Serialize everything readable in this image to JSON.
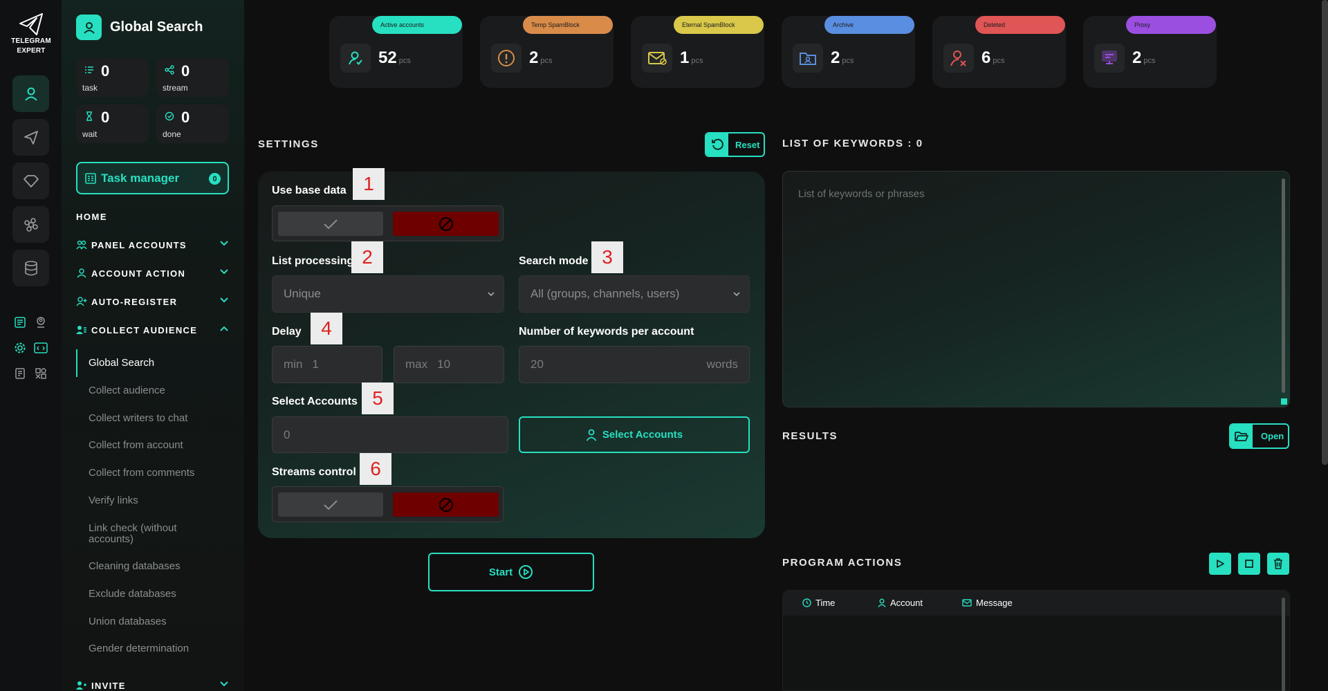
{
  "logo": {
    "line1": "TELEGRAM",
    "line2": "EXPERT"
  },
  "header": {
    "title": "Global Search"
  },
  "stats": [
    {
      "value": "0",
      "label": "task"
    },
    {
      "value": "0",
      "label": "stream"
    },
    {
      "value": "0",
      "label": "wait"
    },
    {
      "value": "0",
      "label": "done"
    }
  ],
  "task_manager": {
    "label": "Task manager",
    "badge": "0"
  },
  "nav": {
    "home": "HOME",
    "sections": [
      {
        "label": "PANEL ACCOUNTS",
        "icon": "users-icon",
        "expanded": false
      },
      {
        "label": "ACCOUNT ACTION",
        "icon": "user-icon",
        "expanded": false
      },
      {
        "label": "AUTO-REGISTER",
        "icon": "user-plus-icon",
        "expanded": false
      },
      {
        "label": "COLLECT AUDIENCE",
        "icon": "user-list-icon",
        "expanded": true
      },
      {
        "label": "INVITE",
        "icon": "user-invite-icon",
        "expanded": false
      }
    ],
    "collect_audience_items": [
      {
        "label": "Global Search",
        "active": true
      },
      {
        "label": "Collect audience"
      },
      {
        "label": "Collect writers to chat"
      },
      {
        "label": "Collect from account"
      },
      {
        "label": "Collect from comments"
      },
      {
        "label": "Verify links"
      },
      {
        "label": "Link check (without accounts)"
      },
      {
        "label": "Cleaning databases"
      },
      {
        "label": "Exclude databases"
      },
      {
        "label": "Union databases"
      },
      {
        "label": "Gender determination"
      }
    ]
  },
  "counters": [
    {
      "tag": "Active accounts",
      "value": "52",
      "unit": "pcs",
      "color": "#27e0c1",
      "icon": "user-check-icon"
    },
    {
      "tag": "Temp SpamBlock",
      "value": "2",
      "unit": "pcs",
      "color": "#d98c4a",
      "icon": "warning-icon"
    },
    {
      "tag": "Eternal SpamBlock",
      "value": "1",
      "unit": "pcs",
      "color": "#d9c84a",
      "icon": "mail-blocked-icon"
    },
    {
      "tag": "Archive",
      "value": "2",
      "unit": "pcs",
      "color": "#5a8ee0",
      "icon": "archive-folder-icon"
    },
    {
      "tag": "Deleted",
      "value": "6",
      "unit": "pcs",
      "color": "#e05555",
      "icon": "user-deleted-icon"
    },
    {
      "tag": "Proxy",
      "value": "2",
      "unit": "pcs",
      "color": "#9b4fe0",
      "icon": "proxy-icon"
    }
  ],
  "settings": {
    "title": "SETTINGS",
    "reset_label": "Reset",
    "use_base_data": {
      "label": "Use base data",
      "marker": "1"
    },
    "list_processing": {
      "label": "List processing",
      "marker": "2",
      "value": "Unique"
    },
    "search_mode": {
      "label": "Search mode",
      "marker": "3",
      "value": "All (groups, channels, users)"
    },
    "delay": {
      "label": "Delay",
      "marker": "4",
      "min_prefix": "min",
      "min_value": "1",
      "max_prefix": "max",
      "max_value": "10"
    },
    "keywords_per_account": {
      "label": "Number of keywords per account",
      "value": "20",
      "suffix": "words"
    },
    "select_accounts": {
      "label": "Select Accounts",
      "marker": "5",
      "value": "0",
      "button": "Select Accounts"
    },
    "streams_control": {
      "label": "Streams control",
      "marker": "6"
    },
    "start_label": "Start"
  },
  "keywords": {
    "title": "LIST OF KEYWORDS : 0",
    "placeholder": "List of keywords or phrases"
  },
  "results": {
    "title": "RESULTS",
    "open_label": "Open"
  },
  "program_actions": {
    "title": "PROGRAM ACTIONS",
    "columns": [
      "Time",
      "Account",
      "Message"
    ]
  }
}
